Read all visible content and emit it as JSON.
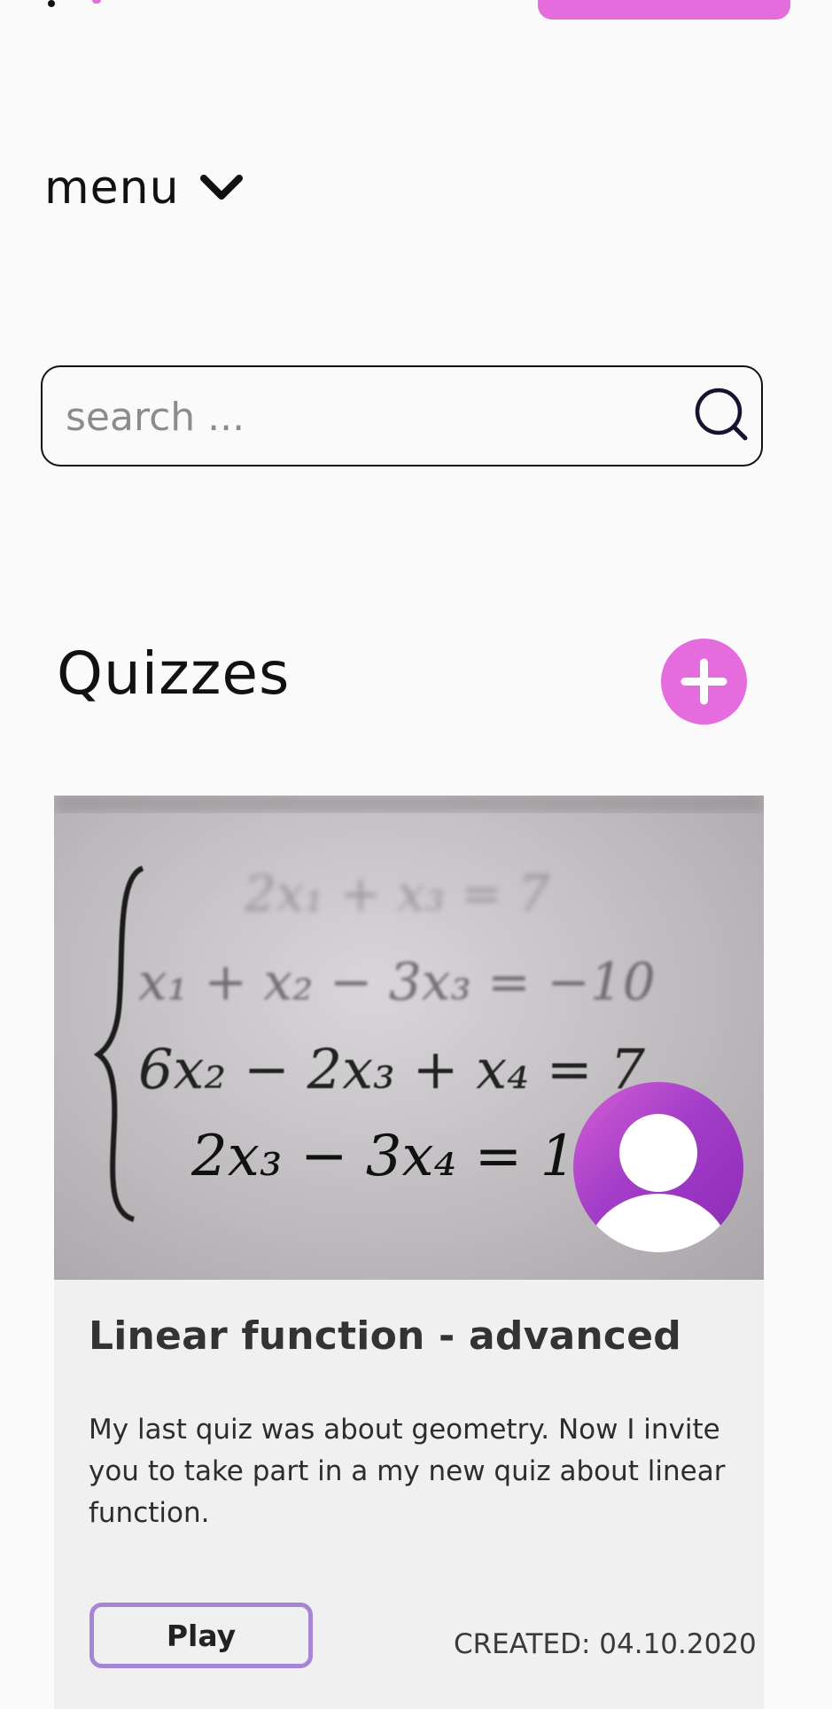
{
  "menu": {
    "label": "menu",
    "icon": "chevron-down-icon"
  },
  "search": {
    "placeholder": "search ...",
    "value": "",
    "icon": "search-icon"
  },
  "section": {
    "title": "Quizzes",
    "add_icon": "plus-icon"
  },
  "quizzes": [
    {
      "image_alt": "system of linear equations",
      "equations": [
        "2x₁ + x₃ = 7",
        "x₁ + x₂ − 3x₃ = −10",
        "6x₂ − 2x₃ + x₄ = 7",
        "2x₃ − 3x₄ = 1"
      ],
      "title": "Linear function - advanced",
      "description": "My last quiz was about geometry. Now I invite you to take part in a my new quiz about linear function.",
      "play_label": "Play",
      "created": "CREATED: 04.10.2020",
      "avatar_icon": "user-avatar-icon"
    }
  ],
  "colors": {
    "accent": "#e56cdc",
    "play_border": "#a485d6",
    "card_background": "#f1f0f1",
    "page_background": "#fbfafb"
  }
}
